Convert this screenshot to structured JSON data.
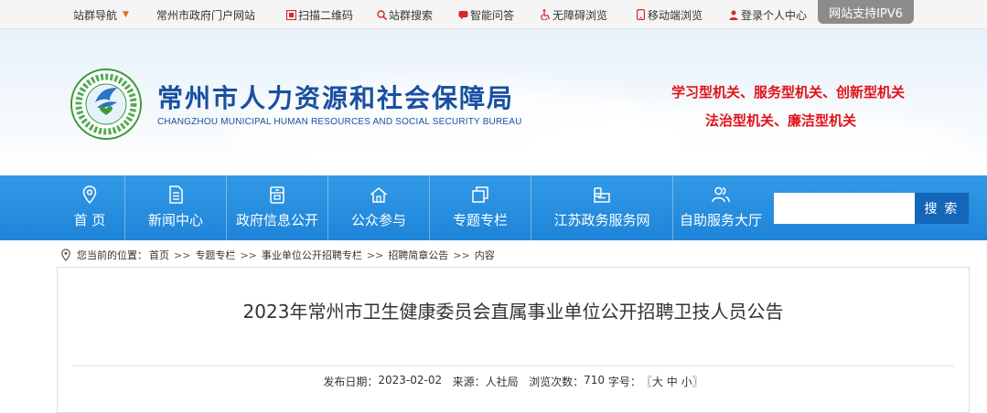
{
  "topbar": {
    "items": [
      {
        "label": "站群导航",
        "icon": "chevron-down-icon"
      },
      {
        "label": "常州市政府门户网站",
        "icon": ""
      },
      {
        "label": "扫描二维码",
        "icon": "qrcode-icon"
      },
      {
        "label": "站群搜索",
        "icon": "search-icon"
      },
      {
        "label": "智能问答",
        "icon": "chat-icon"
      },
      {
        "label": "无障碍浏览",
        "icon": "accessibility-icon"
      },
      {
        "label": "移动端浏览",
        "icon": "mobile-icon"
      },
      {
        "label": "登录个人中心",
        "icon": "user-icon"
      }
    ],
    "ipv6_badge": "网站支持IPV6"
  },
  "header": {
    "title": "常州市人力资源和社会保障局",
    "subtitle": "CHANGZHOU MUNICIPAL HUMAN RESOURCES AND SOCIAL SECURITY BUREAU",
    "slogan_line1": "学习型机关、服务型机关、创新型机关",
    "slogan_line2": "法治型机关、廉洁型机关"
  },
  "nav": {
    "items": [
      {
        "label": "首 页",
        "icon": "location-icon"
      },
      {
        "label": "新闻中心",
        "icon": "document-icon"
      },
      {
        "label": "政府信息公开",
        "icon": "archive-icon"
      },
      {
        "label": "公众参与",
        "icon": "home-icon"
      },
      {
        "label": "专题专栏",
        "icon": "layers-icon"
      },
      {
        "label": "江苏政务服务网",
        "icon": "service-icon"
      },
      {
        "label": "自助服务大厅",
        "icon": "users-icon"
      }
    ],
    "search_placeholder": "",
    "search_button": "搜 索"
  },
  "breadcrumb": {
    "label": "您当前的位置：",
    "items": [
      "首页",
      "专题专栏",
      "事业单位公开招聘专栏",
      "招聘简章公告",
      "内容"
    ],
    "separator": ">>"
  },
  "article": {
    "title": "2023年常州市卫生健康委员会直属事业单位公开招聘卫技人员公告",
    "date_label": "发布日期：",
    "date": "2023-02-02",
    "source_label": "来源：",
    "source": "人社局",
    "views_label": "浏览次数：",
    "views": "710",
    "font_label": "字号：",
    "font_open": "〖",
    "font_large": "大",
    "font_medium": "中",
    "font_small": "小",
    "font_close": "〗"
  },
  "colors": {
    "nav_blue": "#2a8fe0",
    "title_blue": "#1a4fa0",
    "slogan_red": "#e0121a",
    "search_button": "#1466b8",
    "ipv6_badge": "#8c8c8c"
  }
}
